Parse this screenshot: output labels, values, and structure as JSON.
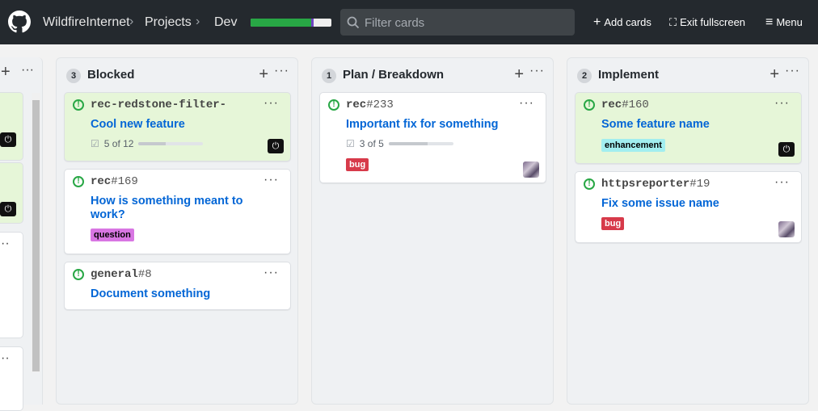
{
  "header": {
    "org": "WildfireInternet",
    "projects": "Projects",
    "project": "Dev",
    "progress": {
      "done": 0.75,
      "in_progress": 0.03
    },
    "search_placeholder": "Filter cards",
    "add_cards": "Add cards",
    "exit_fullscreen": "Exit fullscreen",
    "menu": "Menu"
  },
  "columns": [
    {
      "count": "3",
      "name": "Blocked",
      "cards": [
        {
          "repo": "rec-redstone-filter-",
          "num": "",
          "title": "Cool new feature",
          "tasks": "5 of 12",
          "tasks_ratio": 0.42,
          "green": true
        },
        {
          "repo": "rec",
          "num": "#169",
          "title": "How is something meant to work?",
          "label": "question"
        },
        {
          "repo": "general",
          "num": "#8",
          "title": "Document something"
        }
      ]
    },
    {
      "count": "1",
      "name": "Plan / Breakdown",
      "cards": [
        {
          "repo": "rec",
          "num": "#233",
          "title": "Important fix for something",
          "tasks": "3 of 5",
          "tasks_ratio": 0.6,
          "label": "bug"
        }
      ]
    },
    {
      "count": "2",
      "name": "Implement",
      "cards": [
        {
          "repo": "rec",
          "num": "#160",
          "title": "Some feature name",
          "label": "enhancement",
          "green": true
        },
        {
          "repo": "httpsreporter",
          "num": "#19",
          "title": "Fix some issue name",
          "label": "bug"
        }
      ]
    }
  ],
  "colors": {
    "accent": "#0366d6",
    "green": "#28a745",
    "topbar": "#24292e"
  }
}
